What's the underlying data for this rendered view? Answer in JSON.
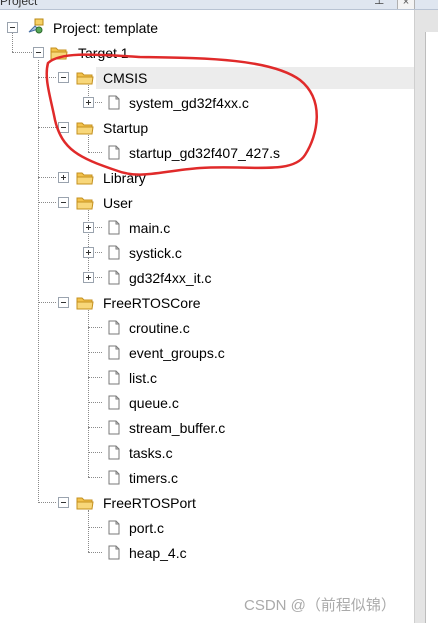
{
  "window": {
    "title": "Project",
    "pin_glyph": "⊥",
    "close_glyph": "×"
  },
  "tree": {
    "project_label": "Project: template",
    "target_label": "Target 1",
    "cmsis_label": "CMSIS",
    "cmsis_file": "system_gd32f4xx.c",
    "startup_label": "Startup",
    "startup_file": "startup_gd32f407_427.s",
    "library_label": "Library",
    "user_label": "User",
    "user_files": [
      "main.c",
      "systick.c",
      "gd32f4xx_it.c"
    ],
    "freertoscore_label": "FreeRTOSCore",
    "freertoscore_files": [
      "croutine.c",
      "event_groups.c",
      "list.c",
      "queue.c",
      "stream_buffer.c",
      "tasks.c",
      "timers.c"
    ],
    "freertosport_label": "FreeRTOSPort",
    "freertosport_files": [
      "port.c",
      "heap_4.c"
    ]
  },
  "watermark": "CSDN @（前程似锦）",
  "colors": {
    "folder_body": "#f3c24b",
    "folder_edge": "#c4901f",
    "selection": "#ececec",
    "annotation": "#e02a2a"
  },
  "icons": [
    "project-icon",
    "folder-icon",
    "file-icon",
    "expand-icon",
    "collapse-icon"
  ]
}
